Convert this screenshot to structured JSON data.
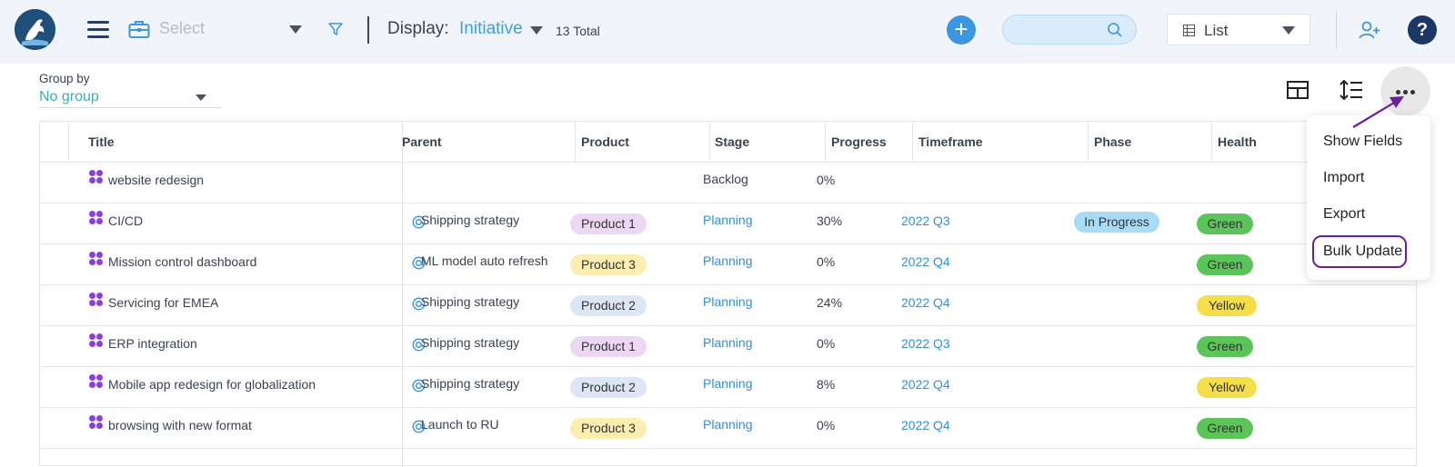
{
  "topbar": {
    "select_placeholder": "Select",
    "display_label": "Display:",
    "display_value": "Initiative",
    "total": "13 Total",
    "search_placeholder": "",
    "view_label": "List",
    "help": "?"
  },
  "groupby": {
    "label": "Group by",
    "value": "No group"
  },
  "table": {
    "columns": [
      "Title",
      "Parent",
      "Product",
      "Stage",
      "Progress",
      "Timeframe",
      "Phase",
      "Health"
    ],
    "rows": [
      {
        "title": "website redesign",
        "parent": "",
        "product": "",
        "stage": "Backlog",
        "progress": "0%",
        "timeframe": "",
        "phase": "",
        "health": ""
      },
      {
        "title": "CI/CD",
        "parent": "Shipping strategy",
        "product": "Product 1",
        "stage": "Planning",
        "progress": "30%",
        "timeframe": "2022 Q3",
        "phase": "In Progress",
        "health": "Green"
      },
      {
        "title": "Mission control dashboard",
        "parent": "ML model auto refresh",
        "product": "Product 3",
        "stage": "Planning",
        "progress": "0%",
        "timeframe": "2022 Q4",
        "phase": "",
        "health": "Green"
      },
      {
        "title": "Servicing for EMEA",
        "parent": "Shipping strategy",
        "product": "Product 2",
        "stage": "Planning",
        "progress": "24%",
        "timeframe": "2022 Q4",
        "phase": "",
        "health": "Yellow"
      },
      {
        "title": "ERP integration",
        "parent": "Shipping strategy",
        "product": "Product 1",
        "stage": "Planning",
        "progress": "0%",
        "timeframe": "2022 Q3",
        "phase": "",
        "health": "Green"
      },
      {
        "title": "Mobile app redesign for globalization",
        "parent": "Shipping strategy",
        "product": "Product 2",
        "stage": "Planning",
        "progress": "8%",
        "timeframe": "2022 Q4",
        "phase": "",
        "health": "Yellow"
      },
      {
        "title": "browsing with new format",
        "parent": "Launch to RU",
        "product": "Product 3",
        "stage": "Planning",
        "progress": "0%",
        "timeframe": "2022 Q4",
        "phase": "",
        "health": "Green"
      }
    ]
  },
  "menu": {
    "items": [
      "Show Fields",
      "Import",
      "Export",
      "Bulk Update"
    ]
  },
  "colors": {
    "product_1": "#ecd8f4",
    "product_2": "#dde6f7",
    "product_3": "#fbeeb0",
    "health_green": "#5cc55a",
    "health_yellow": "#f4df4a",
    "phase_in_progress": "#a7dcf7",
    "accent": "#3c9fe0",
    "highlight": "#6a1fa0"
  }
}
